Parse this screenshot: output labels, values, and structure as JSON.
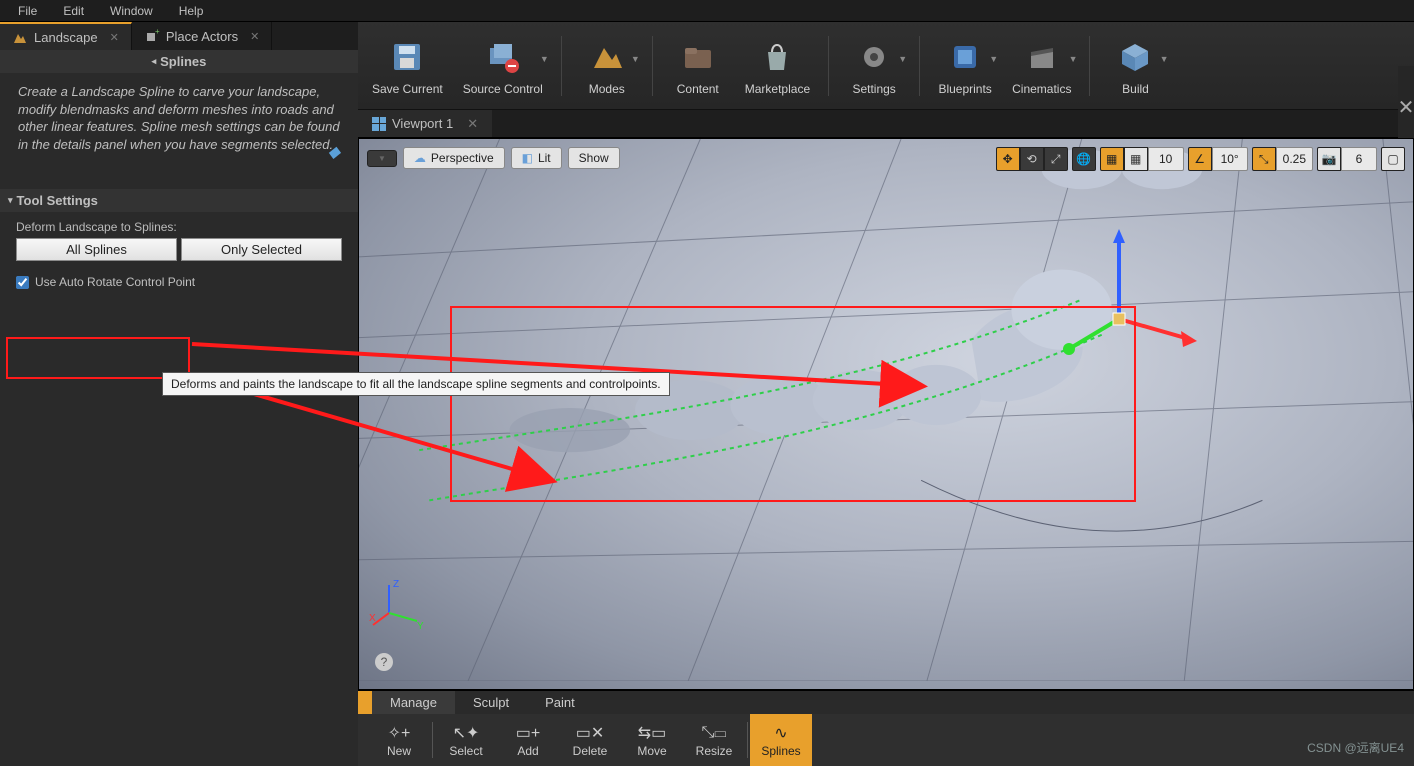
{
  "menubar": [
    "File",
    "Edit",
    "Window",
    "Help"
  ],
  "left_tabs": {
    "landscape": "Landscape",
    "place_actors": "Place Actors"
  },
  "splines_header": "Splines",
  "splines_desc": "Create a Landscape Spline to carve your landscape, modify blendmasks and deform meshes into roads and other linear features.  Spline mesh settings can be found in the details panel when you have  segments selected.",
  "tool_settings_header": "Tool Settings",
  "deform_label": "Deform Landscape to Splines:",
  "btn_all_splines": "All Splines",
  "btn_only_selected": "Only Selected",
  "chk_auto_rotate": "Use Auto Rotate Control Point",
  "tooltip_text": "Deforms and paints the landscape to fit all the landscape spline segments and controlpoints.",
  "toolbar": {
    "save": "Save Current",
    "source_control": "Source Control",
    "modes": "Modes",
    "content": "Content",
    "marketplace": "Marketplace",
    "settings": "Settings",
    "blueprints": "Blueprints",
    "cinematics": "Cinematics",
    "build": "Build"
  },
  "viewport_tab": "Viewport 1",
  "vp_left": {
    "perspective": "Perspective",
    "lit": "Lit",
    "show": "Show"
  },
  "vp_right": {
    "grid_val": "10",
    "angle_val": "10°",
    "scale_val": "0.25",
    "cam_val": "6"
  },
  "axis": {
    "x": "X",
    "y": "Y",
    "z": "Z"
  },
  "watermark": "CSDN @远离UE4",
  "modebar1": [
    "Manage",
    "Sculpt",
    "Paint"
  ],
  "modebar2": [
    "New",
    "Select",
    "Add",
    "Delete",
    "Move",
    "Resize",
    "Splines"
  ],
  "modebar2_active": "Splines",
  "colors": {
    "accent": "#e8a02c",
    "red": "#ff1a1a",
    "axis_x": "#ff3030",
    "axis_y": "#30e030",
    "axis_z": "#3060ff"
  }
}
